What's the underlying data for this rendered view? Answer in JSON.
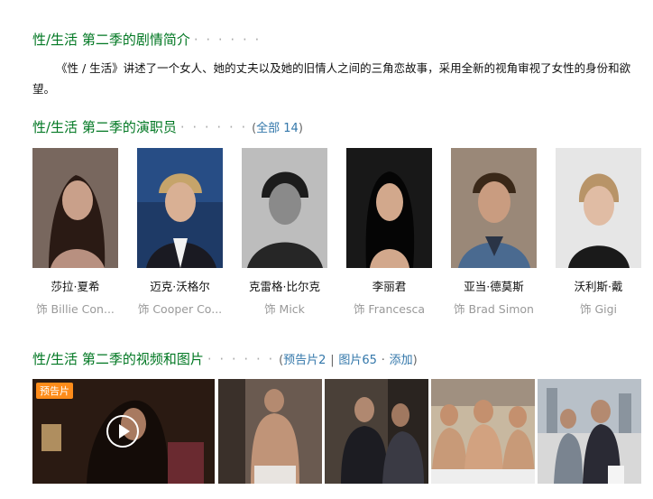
{
  "intro": {
    "heading": "性/生活 第二季的剧情简介",
    "dots": "· · · · · ·",
    "text": "《性 / 生活》讲述了一个女人、她的丈夫以及她的旧情人之间的三角恋故事，采用全新的视角审视了女性的身份和欲望。"
  },
  "cast": {
    "heading": "性/生活 第二季的演职员",
    "dots": "· · · · · ·",
    "all_open": "(",
    "all_link": "全部 14",
    "all_close": ")",
    "members": [
      {
        "name": "莎拉·夏希",
        "role": "饰 Billie Con..."
      },
      {
        "name": "迈克·沃格尔",
        "role": "饰 Cooper Co..."
      },
      {
        "name": "克雷格·比尔克",
        "role": "饰 Mick"
      },
      {
        "name": "李丽君",
        "role": "饰 Francesca"
      },
      {
        "name": "亚当·德莫斯",
        "role": "饰 Brad Simon"
      },
      {
        "name": "沃利斯·戴",
        "role": "饰 Gigi"
      }
    ]
  },
  "media": {
    "heading": "性/生活 第二季的视频和图片",
    "dots": "· · · · · ·",
    "paren_open": "(",
    "trailer_link": "预告片2",
    "sep1": "|",
    "photos_link": "图片65",
    "sep2": "·",
    "add_link": "添加",
    "paren_close": ")",
    "trailer_badge": "预告片"
  }
}
